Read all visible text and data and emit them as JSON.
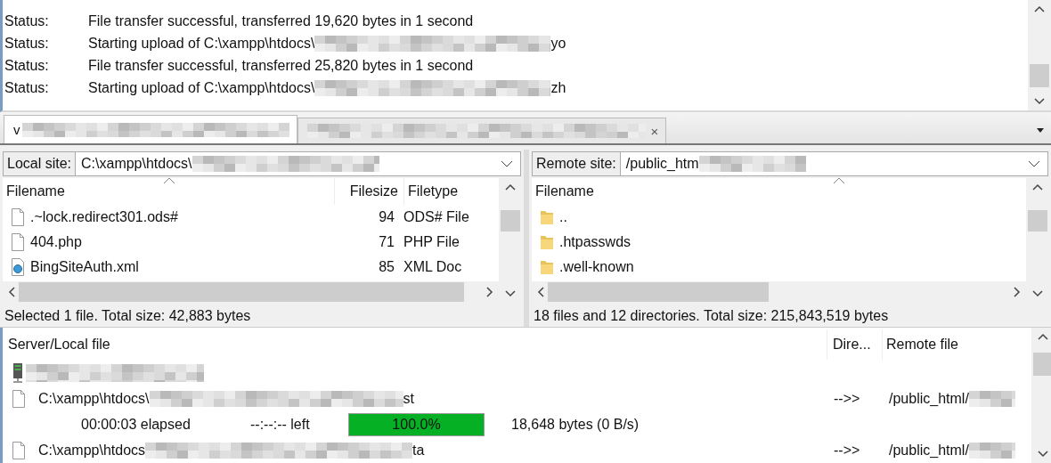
{
  "log": [
    {
      "label": "Status:",
      "text": "File transfer successful, transferred 19,620 bytes in 1 second"
    },
    {
      "label": "Status:",
      "text": "Starting upload of C:\\xampp\\htdocs\\",
      "suffix": "yo"
    },
    {
      "label": "Status:",
      "text": "File transfer successful, transferred 25,820 bytes in 1 second"
    },
    {
      "label": "Status:",
      "text": "Starting upload of C:\\xampp\\htdocs\\",
      "suffix": "zh"
    }
  ],
  "tabs": [
    {
      "label": "v",
      "selected": true
    },
    {
      "close": "×",
      "selected": false
    }
  ],
  "local": {
    "site_label": "Local site:",
    "path": "C:\\xampp\\htdocs\\",
    "columns": [
      "Filename",
      "Filesize",
      "Filetype"
    ],
    "rows": [
      {
        "kind": "file",
        "name": ".~lock.redirect301.ods#",
        "size": "94",
        "type": "ODS# File"
      },
      {
        "kind": "file",
        "name": "404.php",
        "size": "71",
        "type": "PHP File"
      },
      {
        "kind": "xml",
        "name": "BingSiteAuth.xml",
        "size": "85",
        "type": "XML Doc"
      }
    ],
    "status": "Selected 1 file. Total size: 42,883 bytes"
  },
  "remote": {
    "site_label": "Remote site:",
    "path": "/public_htm",
    "columns": [
      "Filename"
    ],
    "rows": [
      {
        "kind": "folder",
        "name": ".."
      },
      {
        "kind": "folder",
        "name": ".htpasswds"
      },
      {
        "kind": "folder",
        "name": ".well-known"
      }
    ],
    "status": "18 files and 12 directories. Total size: 215,843,519 bytes"
  },
  "queue": {
    "columns": [
      "Server/Local file",
      "Dire...",
      "Remote file"
    ],
    "items": [
      {
        "kind": "server"
      },
      {
        "kind": "file",
        "local": "C:\\xampp\\htdocs\\",
        "suffix": "st",
        "direction": "-->>",
        "remote": "/public_html/"
      },
      {
        "kind": "progress",
        "elapsed": "00:00:03 elapsed",
        "left": "--:--:-- left",
        "level": 1,
        "percent": "100.0%",
        "bytes": "18,648 bytes (0 B/s)"
      },
      {
        "kind": "file",
        "local": "C:\\xampp\\htdocs",
        "suffix": "ta",
        "direction": "-->>",
        "remote": "/public_html/"
      }
    ]
  }
}
